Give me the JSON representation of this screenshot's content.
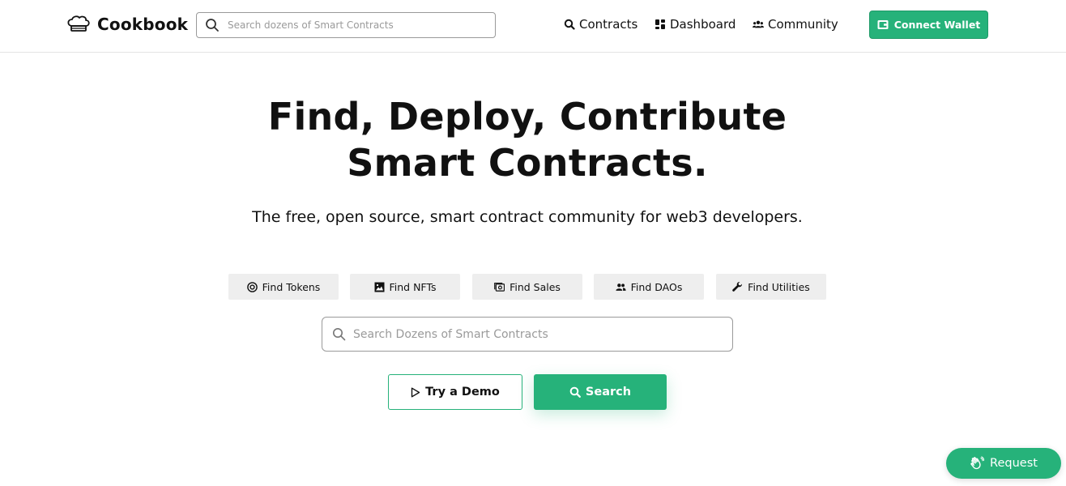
{
  "brand": {
    "name": "Cookbook",
    "accent": "#26b27a"
  },
  "header": {
    "search_placeholder": "Search dozens of Smart Contracts",
    "nav": [
      {
        "label": "Contracts",
        "icon": "search-icon"
      },
      {
        "label": "Dashboard",
        "icon": "dashboard-icon"
      },
      {
        "label": "Community",
        "icon": "community-icon"
      }
    ],
    "connect_wallet": {
      "label": "Connect Wallet",
      "icon": "wallet-icon"
    }
  },
  "hero": {
    "title_line1": "Find, Deploy, Contribute",
    "title_line2": "Smart Contracts.",
    "subtitle": "The free, open source, smart contract community for web3 developers."
  },
  "chips": [
    {
      "label": "Find Tokens",
      "icon": "token-icon"
    },
    {
      "label": "Find NFTs",
      "icon": "image-icon"
    },
    {
      "label": "Find Sales",
      "icon": "sales-icon"
    },
    {
      "label": "Find DAOs",
      "icon": "users-icon"
    },
    {
      "label": "Find Utilities",
      "icon": "wrench-icon"
    }
  ],
  "main_search": {
    "placeholder": "Search Dozens of Smart Contracts"
  },
  "actions": {
    "demo_label": "Try a Demo",
    "search_label": "Search"
  },
  "request": {
    "label": "Request",
    "icon": "hand-wave-icon"
  }
}
